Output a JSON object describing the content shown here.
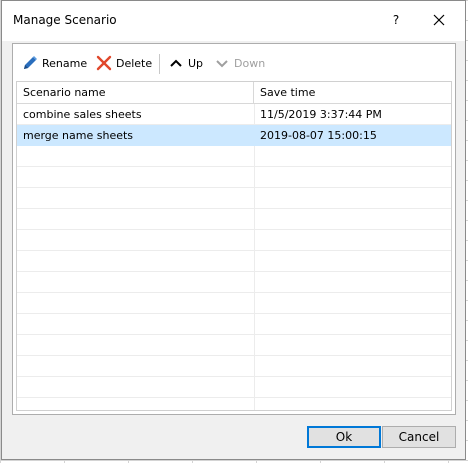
{
  "dialog": {
    "title": "Manage Scenario",
    "help_label": "?"
  },
  "toolbar": {
    "rename_label": "Rename",
    "delete_label": "Delete",
    "up_label": "Up",
    "down_label": "Down",
    "down_enabled": false
  },
  "grid": {
    "columns": [
      "Scenario name",
      "Save time"
    ],
    "rows": [
      {
        "name": "combine sales sheets",
        "time": "11/5/2019 3:37:44 PM",
        "selected": false
      },
      {
        "name": "merge name sheets",
        "time": "2019-08-07 15:00:15",
        "selected": true
      }
    ]
  },
  "buttons": {
    "ok_label": "Ok",
    "cancel_label": "Cancel"
  },
  "colors": {
    "selection": "#cce8ff",
    "accent": "#0078d7",
    "delete_icon": "#e0472b",
    "rename_icon": "#2a6ebd"
  },
  "icons": {
    "rename": "pencil-icon",
    "delete": "x-icon",
    "up": "chevron-up-icon",
    "down": "chevron-down-icon",
    "close": "close-icon"
  }
}
